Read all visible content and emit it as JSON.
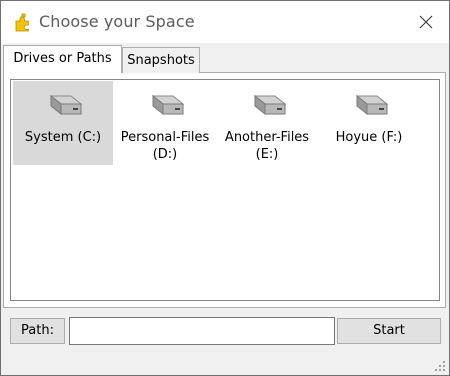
{
  "window": {
    "title": "Choose your Space",
    "app_icon": "puzzle-piece-icon",
    "close_icon": "close-icon"
  },
  "tabs": [
    {
      "label": "Drives or Paths",
      "active": true
    },
    {
      "label": "Snapshots",
      "active": false
    }
  ],
  "drives": [
    {
      "label": "System (C:)",
      "icon": "hard-drive-icon",
      "selected": true
    },
    {
      "label": "Personal-Files (D:)",
      "icon": "hard-drive-icon",
      "selected": false
    },
    {
      "label": "Another-Files (E:)",
      "icon": "hard-drive-icon",
      "selected": false
    },
    {
      "label": "Hoyue (F:)",
      "icon": "hard-drive-icon",
      "selected": false
    }
  ],
  "path": {
    "label": "Path:",
    "value": "",
    "placeholder": ""
  },
  "start_label": "Start",
  "colors": {
    "selection": "#d9d9d9",
    "button_face": "#e1e1e1",
    "icon_yellow": "#f5c400"
  }
}
